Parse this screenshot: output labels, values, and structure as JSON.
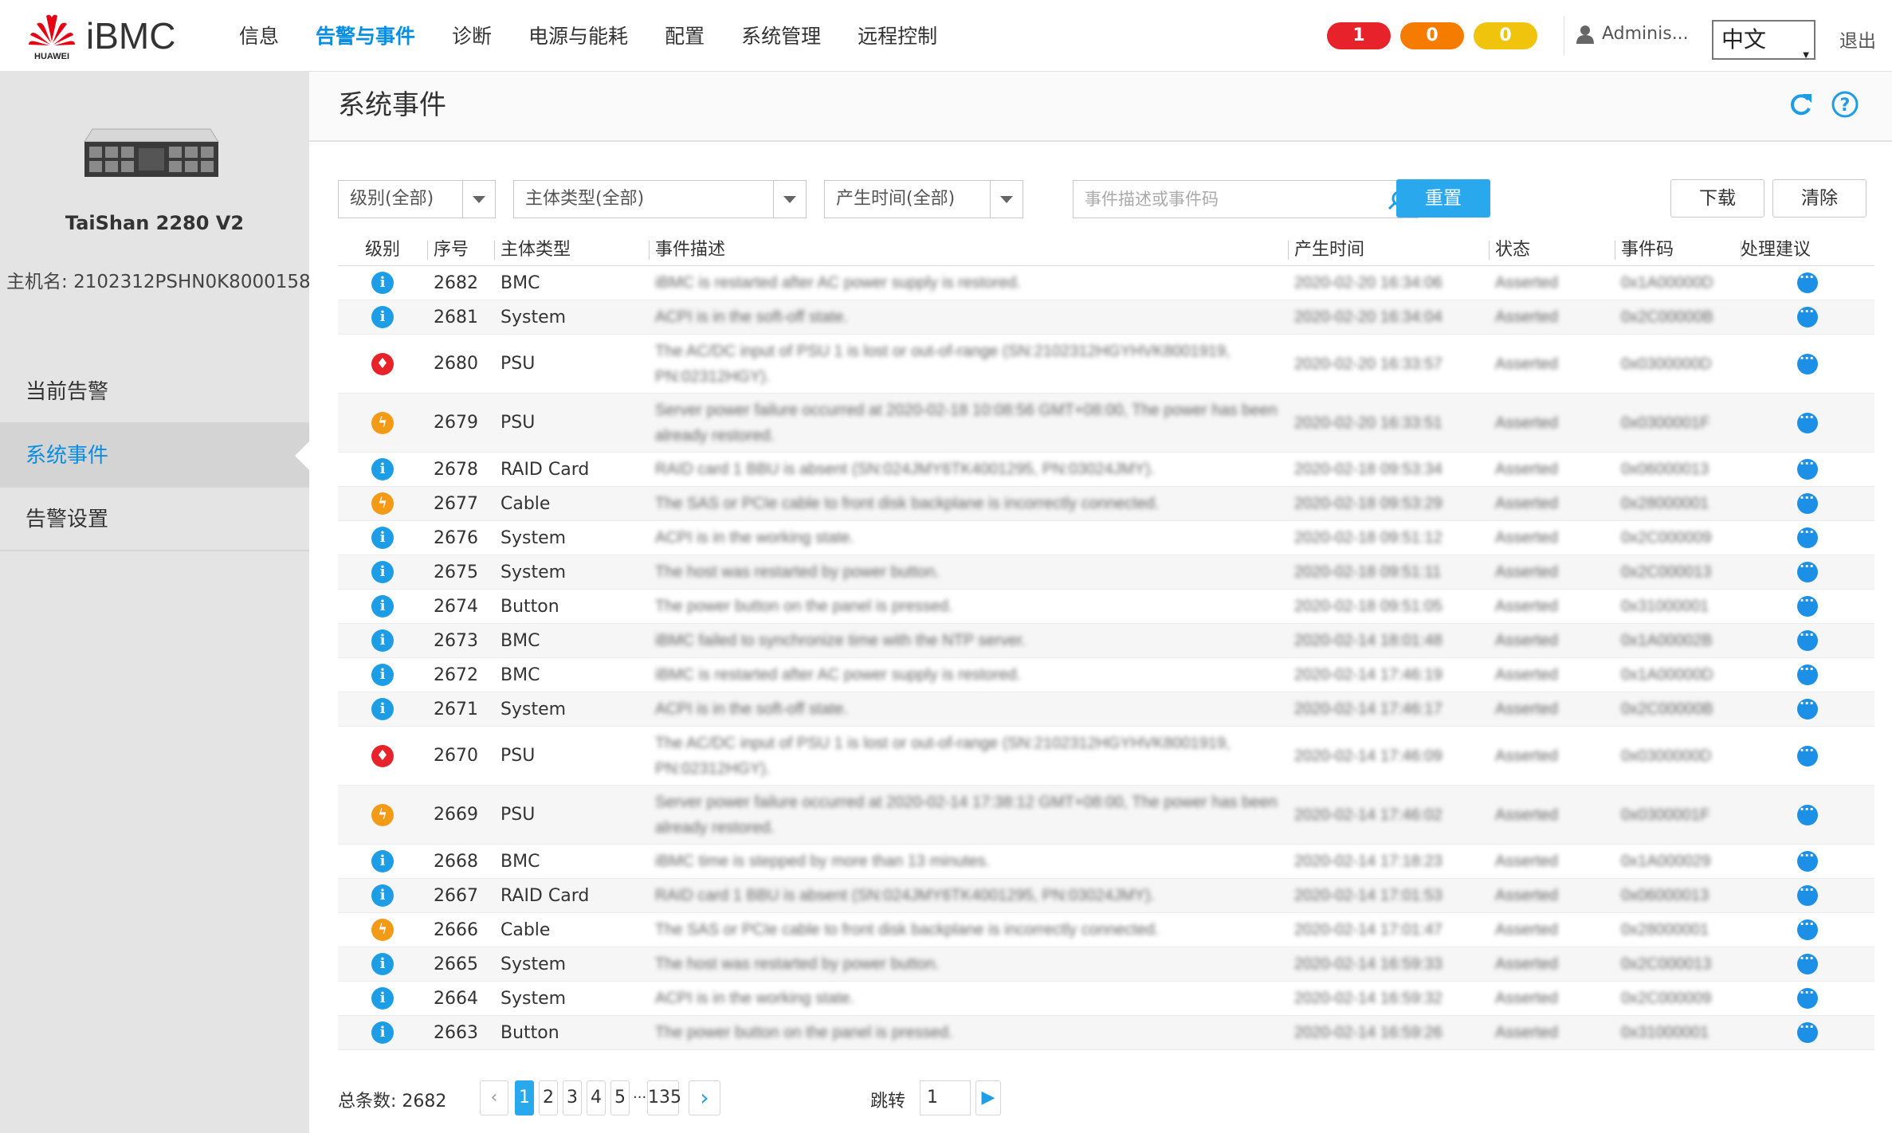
{
  "header": {
    "brand": "iBMC",
    "logo_text": "HUAWEI",
    "nav": [
      "信息",
      "告警与事件",
      "诊断",
      "电源与能耗",
      "配置",
      "系统管理",
      "远程控制"
    ],
    "alarm_counts": {
      "critical": "1",
      "major": "0",
      "minor": "0"
    },
    "user": "Adminis...",
    "language": "中文",
    "logout": "退出"
  },
  "sidebar": {
    "server_name": "TaiShan 2280 V2",
    "hostname_label": "主机名: ",
    "hostname": "2102312PSHN0K8000158",
    "items": [
      "当前告警",
      "系统事件",
      "告警设置"
    ]
  },
  "page": {
    "title": "系统事件",
    "filters": {
      "level": "级别(全部)",
      "subject_type": "主体类型(全部)",
      "time": "产生时间(全部)",
      "search_placeholder": "事件描述或事件码"
    },
    "buttons": {
      "reset": "重置",
      "download": "下载",
      "clear": "清除"
    }
  },
  "table": {
    "headers": [
      "级别",
      "序号",
      "主体类型",
      "事件描述",
      "产生时间",
      "状态",
      "事件码",
      "处理建议"
    ],
    "rows": [
      {
        "level": "info",
        "seq": "2682",
        "type": "BMC",
        "desc": "iBMC is restarted after AC power supply is restored.",
        "time": "2020-02-20 16:34:06",
        "state": "Asserted",
        "code": "0x1A00000D"
      },
      {
        "level": "info",
        "seq": "2681",
        "type": "System",
        "desc": "ACPI is in the soft-off state.",
        "time": "2020-02-20 16:34:04",
        "state": "Asserted",
        "code": "0x2C00000B"
      },
      {
        "level": "critical",
        "seq": "2680",
        "type": "PSU",
        "desc": "The AC/DC input of PSU 1 is lost or out-of-range (SN:2102312HGYHVK8001919, PN:02312HGY).",
        "time": "2020-02-20 16:33:57",
        "state": "Asserted",
        "code": "0x0300000D"
      },
      {
        "level": "major",
        "seq": "2679",
        "type": "PSU",
        "desc": "Server power failure occurred at 2020-02-18 10:08:56 GMT+08:00, The power has been already restored.",
        "time": "2020-02-20 16:33:51",
        "state": "Asserted",
        "code": "0x0300001F"
      },
      {
        "level": "info",
        "seq": "2678",
        "type": "RAID Card",
        "desc": "RAID card 1 BBU is absent (SN:024JMY6TK4001295, PN:03024JMY).",
        "time": "2020-02-18 09:53:34",
        "state": "Asserted",
        "code": "0x06000013"
      },
      {
        "level": "major",
        "seq": "2677",
        "type": "Cable",
        "desc": "The SAS or PCIe cable to front disk backplane is incorrectly connected.",
        "time": "2020-02-18 09:53:29",
        "state": "Asserted",
        "code": "0x28000001"
      },
      {
        "level": "info",
        "seq": "2676",
        "type": "System",
        "desc": "ACPI is in the working state.",
        "time": "2020-02-18 09:51:12",
        "state": "Asserted",
        "code": "0x2C000009"
      },
      {
        "level": "info",
        "seq": "2675",
        "type": "System",
        "desc": "The host was restarted by power button.",
        "time": "2020-02-18 09:51:11",
        "state": "Asserted",
        "code": "0x2C000013"
      },
      {
        "level": "info",
        "seq": "2674",
        "type": "Button",
        "desc": "The power button on the panel is pressed.",
        "time": "2020-02-18 09:51:05",
        "state": "Asserted",
        "code": "0x31000001"
      },
      {
        "level": "info",
        "seq": "2673",
        "type": "BMC",
        "desc": "iBMC failed to synchronize time with the NTP server.",
        "time": "2020-02-14 18:01:48",
        "state": "Asserted",
        "code": "0x1A00002B"
      },
      {
        "level": "info",
        "seq": "2672",
        "type": "BMC",
        "desc": "iBMC is restarted after AC power supply is restored.",
        "time": "2020-02-14 17:46:19",
        "state": "Asserted",
        "code": "0x1A00000D"
      },
      {
        "level": "info",
        "seq": "2671",
        "type": "System",
        "desc": "ACPI is in the soft-off state.",
        "time": "2020-02-14 17:46:17",
        "state": "Asserted",
        "code": "0x2C00000B"
      },
      {
        "level": "critical",
        "seq": "2670",
        "type": "PSU",
        "desc": "The AC/DC input of PSU 1 is lost or out-of-range (SN:2102312HGYHVK8001919, PN:02312HGY).",
        "time": "2020-02-14 17:46:09",
        "state": "Asserted",
        "code": "0x0300000D"
      },
      {
        "level": "major",
        "seq": "2669",
        "type": "PSU",
        "desc": "Server power failure occurred at 2020-02-14 17:38:12 GMT+08:00, The power has been already restored.",
        "time": "2020-02-14 17:46:02",
        "state": "Asserted",
        "code": "0x0300001F"
      },
      {
        "level": "info",
        "seq": "2668",
        "type": "BMC",
        "desc": "iBMC time is stepped by more than 13 minutes.",
        "time": "2020-02-14 17:18:23",
        "state": "Asserted",
        "code": "0x1A000029"
      },
      {
        "level": "info",
        "seq": "2667",
        "type": "RAID Card",
        "desc": "RAID card 1 BBU is absent (SN:024JMY6TK4001295, PN:03024JMY).",
        "time": "2020-02-14 17:01:53",
        "state": "Asserted",
        "code": "0x06000013"
      },
      {
        "level": "major",
        "seq": "2666",
        "type": "Cable",
        "desc": "The SAS or PCIe cable to front disk backplane is incorrectly connected.",
        "time": "2020-02-14 17:01:47",
        "state": "Asserted",
        "code": "0x28000001"
      },
      {
        "level": "info",
        "seq": "2665",
        "type": "System",
        "desc": "The host was restarted by power button.",
        "time": "2020-02-14 16:59:33",
        "state": "Asserted",
        "code": "0x2C000013"
      },
      {
        "level": "info",
        "seq": "2664",
        "type": "System",
        "desc": "ACPI is in the working state.",
        "time": "2020-02-14 16:59:32",
        "state": "Asserted",
        "code": "0x2C000009"
      },
      {
        "level": "info",
        "seq": "2663",
        "type": "Button",
        "desc": "The power button on the panel is pressed.",
        "time": "2020-02-14 16:59:26",
        "state": "Asserted",
        "code": "0x31000001"
      }
    ]
  },
  "pagination": {
    "total_label": "总条数: 2682",
    "pages": [
      "1",
      "2",
      "3",
      "4",
      "5",
      "...",
      "135"
    ],
    "current": "1",
    "jump_label": "跳转",
    "jump_value": "1"
  },
  "colors": {
    "accent": "#29a8ee",
    "critical": "#e8222a",
    "major": "#f39a17",
    "minor": "#f0c30c",
    "info": "#1c9de6"
  }
}
